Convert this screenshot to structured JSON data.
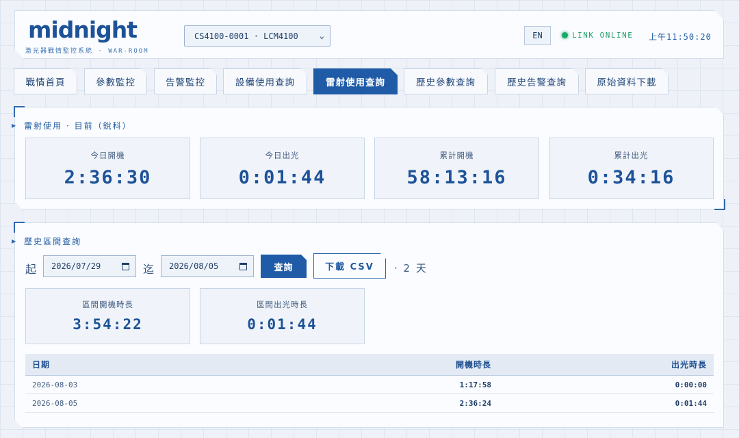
{
  "header": {
    "logo": "midnight",
    "subtitle": "激光器戰情監控系統  ·  WAR-ROOM",
    "device_select": "CS4100-0001 · LCM4100",
    "lang_button": "EN",
    "link_status": "LINK ONLINE",
    "clock": "上午11:50:20"
  },
  "tabs": [
    {
      "label": "戰情首頁"
    },
    {
      "label": "參數監控"
    },
    {
      "label": "告警監控"
    },
    {
      "label": "設備使用查詢"
    },
    {
      "label": "雷射使用查詢",
      "active": true
    },
    {
      "label": "歷史參數查詢"
    },
    {
      "label": "歷史告警查詢"
    },
    {
      "label": "原始資料下載"
    }
  ],
  "usage": {
    "title": "雷射使用  ·  目前（銳科）",
    "cards": [
      {
        "label": "今日開機",
        "value": "2:36:30"
      },
      {
        "label": "今日出光",
        "value": "0:01:44"
      },
      {
        "label": "累計開機",
        "value": "58:13:16"
      },
      {
        "label": "累計出光",
        "value": "0:34:16"
      }
    ]
  },
  "history": {
    "title": "歷史區間查詢",
    "from_label": "起",
    "from_date": "2026/07/29",
    "to_label": "迄",
    "to_date": "2026/08/05",
    "query_button": "查詢",
    "csv_button": "下載 CSV",
    "days_text": "· 2 天",
    "cards": [
      {
        "label": "區間開機時長",
        "value": "3:54:22"
      },
      {
        "label": "區間出光時長",
        "value": "0:01:44"
      }
    ],
    "table": {
      "headers": [
        "日期",
        "開機時長",
        "出光時長"
      ],
      "rows": [
        [
          "2026-08-03",
          "1:17:58",
          "0:00:00"
        ],
        [
          "2026-08-05",
          "2:36:24",
          "0:01:44"
        ]
      ]
    }
  },
  "colors": {
    "accent": "#1f5ba7",
    "online": "#19a86a",
    "background": "#eef2f8"
  }
}
